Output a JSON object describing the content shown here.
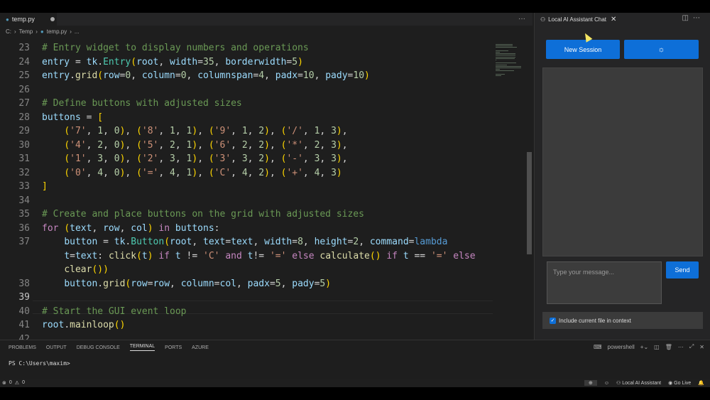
{
  "editor": {
    "tab_label": "temp.py",
    "tab_icon": "python-file-icon",
    "more_label": "···",
    "breadcrumb": {
      "root": "C:",
      "folder": "Temp",
      "file": "temp.py",
      "tail": "..."
    },
    "lines": [
      {
        "n": "23",
        "text": "# Entry widget to display numbers and operations"
      },
      {
        "n": "24",
        "text": "entry = tk.Entry(root, width=35, borderwidth=5)"
      },
      {
        "n": "25",
        "text": "entry.grid(row=0, column=0, columnspan=4, padx=10, pady=10)"
      },
      {
        "n": "26",
        "text": ""
      },
      {
        "n": "27",
        "text": "# Define buttons with adjusted sizes"
      },
      {
        "n": "28",
        "text": "buttons = ["
      },
      {
        "n": "29",
        "text": "    ('7', 1, 0), ('8', 1, 1), ('9', 1, 2), ('/', 1, 3),"
      },
      {
        "n": "30",
        "text": "    ('4', 2, 0), ('5', 2, 1), ('6', 2, 2), ('*', 2, 3),"
      },
      {
        "n": "31",
        "text": "    ('1', 3, 0), ('2', 3, 1), ('3', 3, 2), ('-', 3, 3),"
      },
      {
        "n": "32",
        "text": "    ('0', 4, 0), ('=', 4, 1), ('C', 4, 2), ('+', 4, 3)"
      },
      {
        "n": "33",
        "text": "]"
      },
      {
        "n": "34",
        "text": ""
      },
      {
        "n": "35",
        "text": "# Create and place buttons on the grid with adjusted sizes"
      },
      {
        "n": "36",
        "text": "for (text, row, col) in buttons:"
      },
      {
        "n": "37",
        "text": "    button = tk.Button(root, text=text, width=8, height=2, command=lambda"
      },
      {
        "n": "",
        "text": "    t=text: click(t) if t != 'C' and t!= '=' else calculate() if t == '=' else"
      },
      {
        "n": "",
        "text": "    clear())"
      },
      {
        "n": "38",
        "text": "    button.grid(row=row, column=col, padx=5, pady=5)"
      },
      {
        "n": "39",
        "text": ""
      },
      {
        "n": "40",
        "text": "# Start the GUI event loop"
      },
      {
        "n": "41",
        "text": "root.mainloop()"
      },
      {
        "n": "42",
        "text": ""
      }
    ]
  },
  "chat": {
    "tab_label": "Local AI Assistant Chat",
    "close_label": "✕",
    "new_session_label": "New Session",
    "theme_icon": "☼",
    "input_placeholder": "Type your message...",
    "send_label": "Send",
    "include_context_label": "Include current file in context",
    "include_context_checked": true
  },
  "panel": {
    "tabs": [
      "PROBLEMS",
      "OUTPUT",
      "DEBUG CONSOLE",
      "TERMINAL",
      "PORTS",
      "AZURE"
    ],
    "active_tab": "TERMINAL",
    "shell_label": "powershell",
    "prompt": "PS C:\\Users\\maxim>"
  },
  "status": {
    "errors": "0",
    "warnings": "0",
    "assistant_label": "Local AI Assistant",
    "go_live_label": "Go Live"
  },
  "colors": {
    "accent": "#0e6fd8",
    "editor_bg": "#1e1e1e",
    "panel_bg": "#252526"
  }
}
